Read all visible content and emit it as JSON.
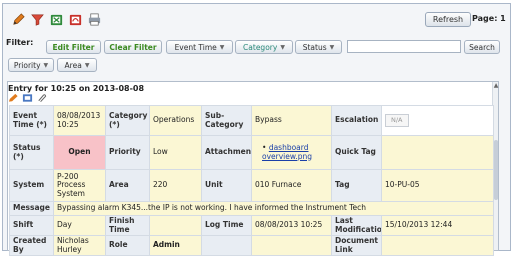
{
  "toolbar": {
    "icons": [
      "pencil-icon",
      "funnel-icon",
      "export-excel-icon",
      "export-pdf-icon",
      "print-icon"
    ],
    "refresh_label": "Refresh",
    "page_label": "Page: 1"
  },
  "filter": {
    "label": "Filter:",
    "edit_filter": "Edit Filter",
    "clear_filter": "Clear Filter",
    "dropdowns": [
      "Event Time",
      "Category",
      "Status",
      "Priority",
      "Area"
    ],
    "search_value": "",
    "search_label": "Search"
  },
  "entry": {
    "title": "Entry for 10:25 on 2013-08-08",
    "rows": {
      "event_time_label": "Event Time (*)",
      "event_time": "08/08/2013 10:25",
      "category_label": "Category (*)",
      "category": "Operations",
      "subcategory_label": "Sub-Category",
      "subcategory": "Bypass",
      "escalation_label": "Escalation",
      "escalation": "N/A",
      "status_label": "Status (*)",
      "status": "Open",
      "priority_label": "Priority",
      "priority": "Low",
      "attachment_label": "Attachment",
      "attachment": "dashboard overview.png",
      "quick_tag_label": "Quick Tag",
      "quick_tag": "",
      "system_label": "System",
      "system": "P-200 Process System",
      "area_label": "Area",
      "area": "220",
      "unit_label": "Unit",
      "unit": "010 Furnace",
      "tag_label": "Tag",
      "tag": "10-PU-05",
      "message_label": "Message",
      "message": "Bypassing alarm K345...the IP is not working. I have informed the Instrument Tech",
      "shift_label": "Shift",
      "shift": "Day",
      "finish_time_label": "Finish Time",
      "finish_time": "",
      "log_time_label": "Log Time",
      "log_time": "08/08/2013 10:25",
      "last_mod_label": "Last Modification",
      "last_mod": "15/10/2013 12:44",
      "created_by_label": "Created By",
      "created_by": "Nicholas Hurley",
      "role_label": "Role",
      "role": "Admin",
      "doc_link_label": "Document Link",
      "doc_link": ""
    }
  },
  "colors": {
    "label_bg": "#e8edf3",
    "value_bg": "#fbf7d4",
    "status_open_bg": "#f8c2c8",
    "edit_filter_text": "#3b8a20"
  }
}
